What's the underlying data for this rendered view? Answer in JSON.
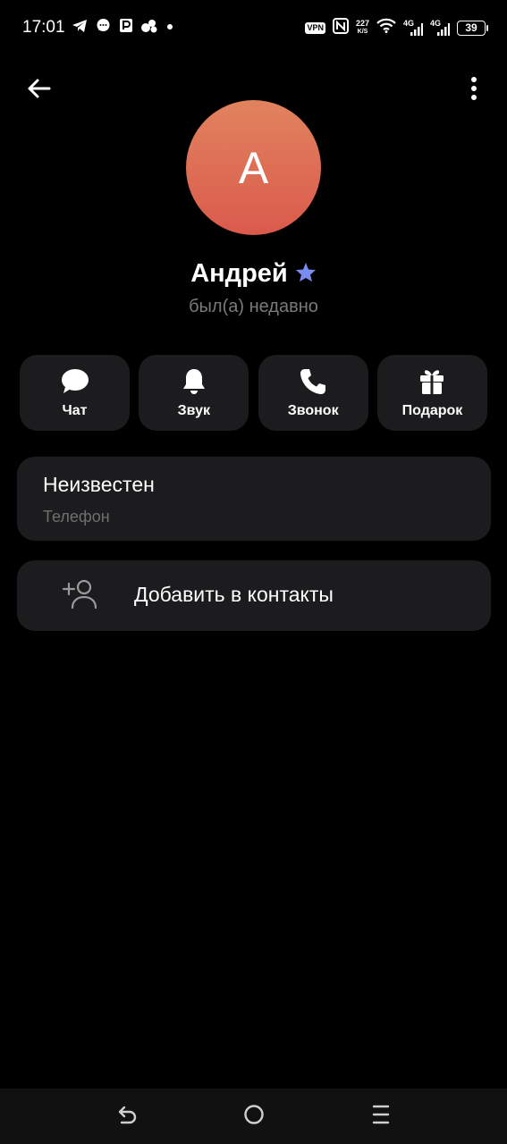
{
  "status_bar": {
    "time": "17:01",
    "notification_icons": [
      "telegram-icon",
      "chat-bubble-icon",
      "parking-icon",
      "social-icon",
      "dot-icon"
    ],
    "vpn": "VPN",
    "nfc": "N",
    "speed_value": "227",
    "speed_unit": "K/S",
    "network_1": "4G",
    "network_2": "4G",
    "battery": "39"
  },
  "header": {
    "back_icon": "arrow-left-icon",
    "menu_icon": "more-vertical-icon"
  },
  "profile": {
    "avatar_letter": "А",
    "avatar_color_top": "#e1835e",
    "avatar_color_bottom": "#da5a4c",
    "name": "Андрей",
    "badge_icon": "star-icon",
    "badge_color": "#7b8cf0",
    "last_seen": "был(а) недавно"
  },
  "actions": [
    {
      "icon": "chat-icon",
      "label": "Чат"
    },
    {
      "icon": "bell-icon",
      "label": "Звук"
    },
    {
      "icon": "phone-icon",
      "label": "Звонок"
    },
    {
      "icon": "gift-icon",
      "label": "Подарок"
    }
  ],
  "phone": {
    "value": "Неизвестен",
    "label": "Телефон"
  },
  "add_contact": {
    "icon": "add-person-icon",
    "label": "Добавить в контакты"
  },
  "nav_bar": {
    "back": "back-nav-icon",
    "home": "home-nav-icon",
    "recents": "recents-nav-icon"
  },
  "colors": {
    "background": "#000000",
    "card": "#1c1c1e",
    "secondary_text": "#7a7a7a"
  }
}
